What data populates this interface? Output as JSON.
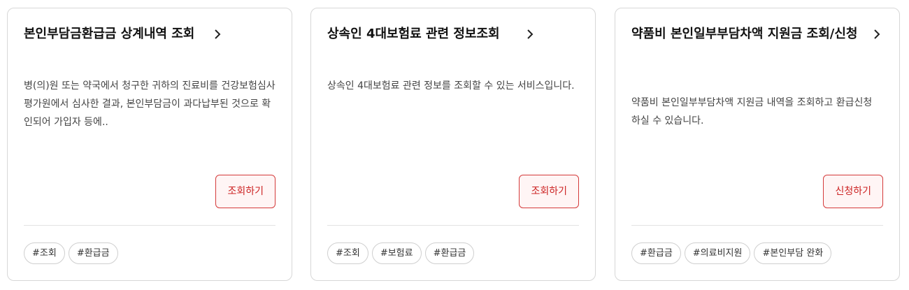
{
  "cards": [
    {
      "title": "본인부담금환급금 상계내역 조회",
      "description": "병(의)원 또는 약국에서 청구한 귀하의 진료비를 건강보험심사평가원에서 심사한 결과, 본인부담금이 과다납부된 것으로 확인되어 가입자 등에..",
      "button_label": "조회하기",
      "tags": [
        "#조회",
        "#환급금"
      ]
    },
    {
      "title": "상속인 4대보험료 관련 정보조회",
      "description": "상속인 4대보험료 관련 정보를 조회할 수 있는 서비스입니다.",
      "button_label": "조회하기",
      "tags": [
        "#조회",
        "#보험료",
        "#환급금"
      ]
    },
    {
      "title": "약품비 본인일부부담차액 지원금 조회/신청",
      "description": "약품비 본인일부부담차액 지원금 내역을 조회하고 환급신청 하실 수 있습니다.",
      "button_label": "신청하기",
      "tags": [
        "#환급금",
        "#의료비지원",
        "#본인부담 완화"
      ]
    }
  ],
  "colors": {
    "accent": "#cc2222",
    "button_bg": "#fff5f5",
    "border": "#d7d7d7"
  },
  "icons": {
    "title_arrow": "chevron-right-icon"
  }
}
